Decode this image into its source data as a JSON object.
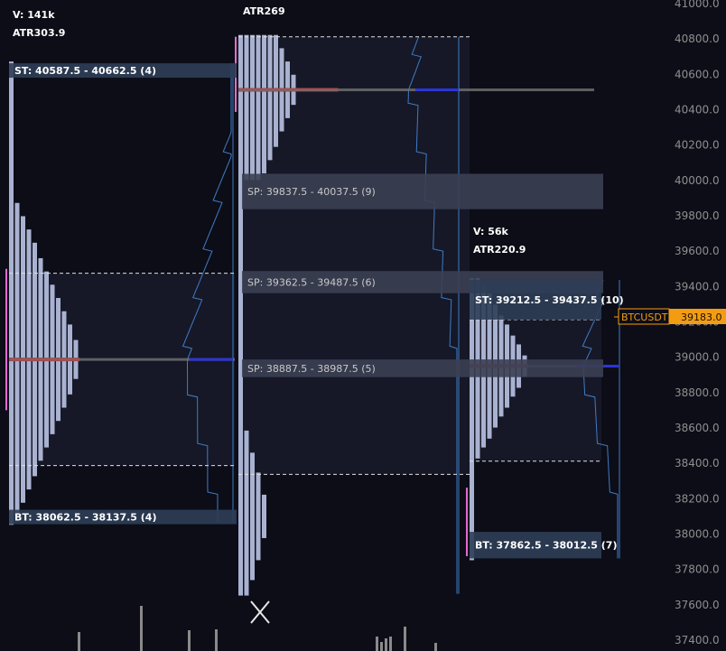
{
  "chart_data": {
    "type": "market-profile",
    "instrument": "BTCUSDT",
    "last_price": 39183.0,
    "price_scale": {
      "min": 37400,
      "max": 41000,
      "step": 200,
      "tick_labels": [
        "41000.0",
        "40800.0",
        "40600.0",
        "40400.0",
        "40200.0",
        "40000.0",
        "39800.0",
        "39600.0",
        "39400.0",
        "39200.0",
        "39000.0",
        "38800.0",
        "38600.0",
        "38400.0",
        "38200.0",
        "38000.0",
        "37800.0",
        "37600.0",
        "37400.0"
      ]
    },
    "current_price_label": "BTCUSDT",
    "current_price_value": "39183.0",
    "sessions": [
      {
        "name": "session-1",
        "volume_label": "V: 141k",
        "atr_label": "ATR303.9",
        "high": 40662.5,
        "low": 38062.5,
        "poc": 38987.5,
        "value_area_high": 39475,
        "value_area_low": 38387.5,
        "single_prints": [
          {
            "type": "ST",
            "label": "ST: 40587.5 - 40662.5 (4)",
            "from": 40587.5,
            "to": 40662.5
          },
          {
            "type": "BT",
            "label": "BT: 38062.5 - 38137.5 (4)",
            "from": 38062.5,
            "to": 38137.5
          }
        ]
      },
      {
        "name": "session-2",
        "volume_label": "",
        "atr_label": "ATR269",
        "high": 40812.5,
        "low": 37662.5,
        "poc": 40512.5,
        "value_area_high": 40812.5,
        "value_area_low": 38337.5,
        "single_prints": [
          {
            "type": "SP",
            "label": "SP: 39837.5 - 40037.5 (9)",
            "from": 39837.5,
            "to": 40037.5
          },
          {
            "type": "SP",
            "label": "SP: 39362.5 - 39487.5 (6)",
            "from": 39362.5,
            "to": 39487.5
          },
          {
            "type": "SP",
            "label": "SP: 38887.5 - 38987.5 (5)",
            "from": 38887.5,
            "to": 38987.5
          }
        ]
      },
      {
        "name": "session-3",
        "volume_label": "V: 56k",
        "atr_label": "ATR220.9",
        "high": 39437.5,
        "low": 37862.5,
        "poc": 38950,
        "value_area_high": 39212.5,
        "value_area_low": 38412.5,
        "single_prints": [
          {
            "type": "ST",
            "label": "ST: 39212.5 - 39437.5 (10)",
            "from": 39212.5,
            "to": 39437.5
          },
          {
            "type": "BT",
            "label": "BT: 37862.5 - 38012.5 (7)",
            "from": 37862.5,
            "to": 38012.5
          }
        ]
      }
    ]
  }
}
